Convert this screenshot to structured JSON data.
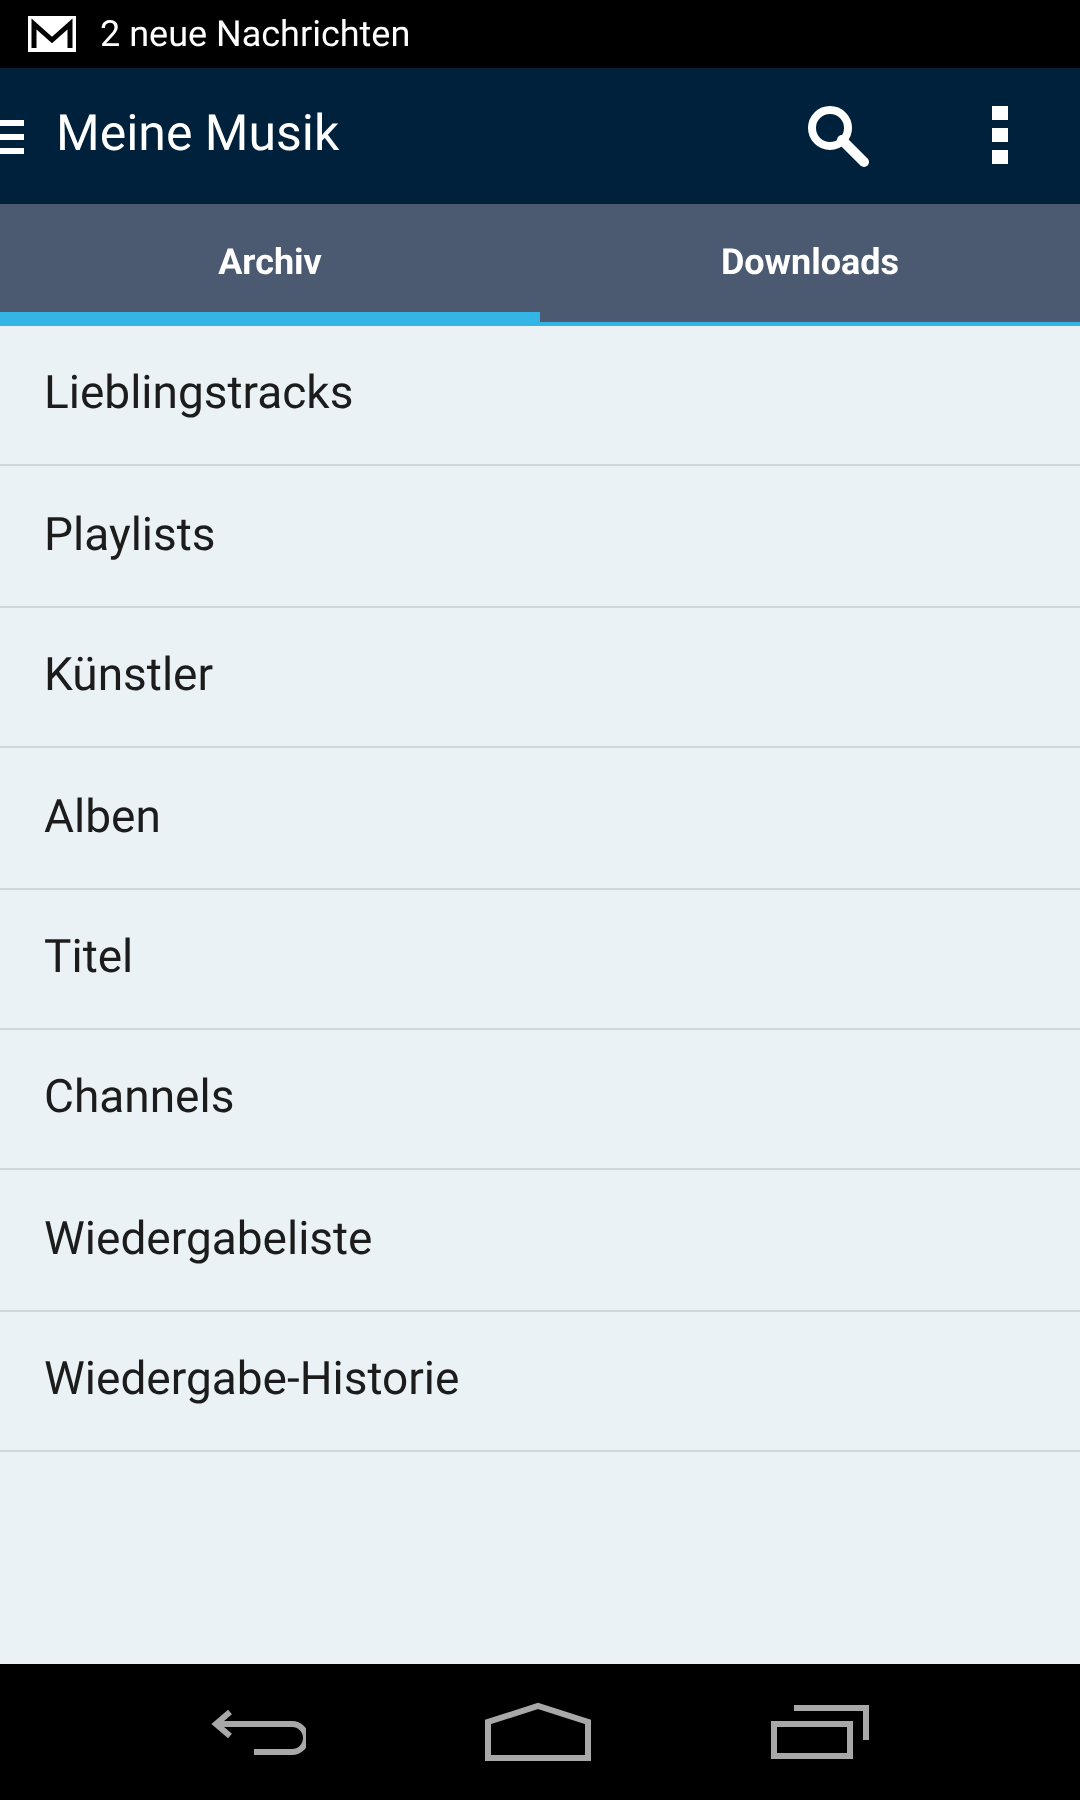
{
  "status_bar": {
    "notification": "2 neue Nachrichten"
  },
  "app_bar": {
    "title": "Meine Musik"
  },
  "tabs": [
    {
      "label": "Archiv",
      "selected": true
    },
    {
      "label": "Downloads",
      "selected": false
    }
  ],
  "items": [
    "Lieblingstracks",
    "Playlists",
    "Künstler",
    "Alben",
    "Titel",
    "Channels",
    "Wiedergabeliste",
    "Wiedergabe-Historie"
  ]
}
